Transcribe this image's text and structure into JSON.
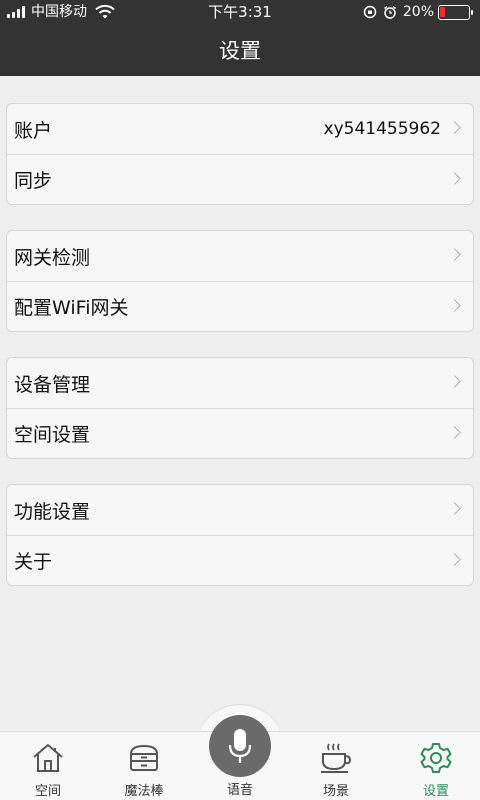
{
  "status_bar": {
    "carrier": "中国移动",
    "time": "下午3:31",
    "battery": "20%",
    "battery_level": 0.2
  },
  "header": {
    "title": "设置"
  },
  "groups": [
    {
      "items": [
        {
          "label": "账户",
          "value": "xy541455962"
        },
        {
          "label": "同步"
        }
      ]
    },
    {
      "items": [
        {
          "label": "网关检测"
        },
        {
          "label": "配置WiFi网关"
        }
      ]
    },
    {
      "items": [
        {
          "label": "设备管理"
        },
        {
          "label": "空间设置"
        }
      ]
    },
    {
      "items": [
        {
          "label": "功能设置"
        },
        {
          "label": "关于"
        }
      ]
    }
  ],
  "tabbar": {
    "tabs": [
      {
        "label": "空间",
        "icon": "house-icon"
      },
      {
        "label": "魔法棒",
        "icon": "cabinet-icon"
      },
      {
        "label": "语音",
        "icon": "microphone-icon"
      },
      {
        "label": "场景",
        "icon": "coffee-cup-icon"
      },
      {
        "label": "设置",
        "icon": "gear-icon"
      }
    ],
    "active_color": "#2f8a5c"
  }
}
